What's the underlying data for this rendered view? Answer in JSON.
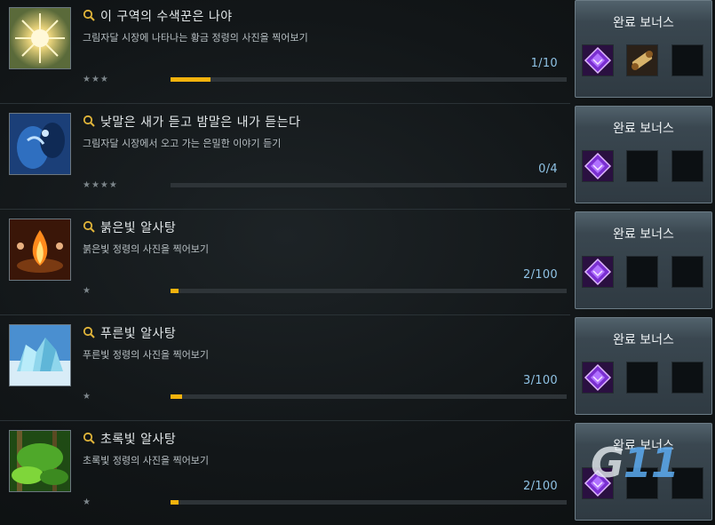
{
  "bonus_label": "완료 보너스",
  "watermark": {
    "prefix": "G",
    "suffix": "11"
  },
  "quests": [
    {
      "title": "이 구역의 수색꾼은 나야",
      "desc": "그림자달 시장에 나타나는 황금 정령의 사진을 찍어보기",
      "count": "1/10",
      "progress": 0.1,
      "stars": "★★★",
      "thumb": "golden-spirit",
      "rewards": [
        "purple-gem-icon",
        "scroll-icon"
      ]
    },
    {
      "title": "낮말은 새가 듣고 밤말은 내가 듣는다",
      "desc": "그림자달 시장에서 오고 가는 은밀한 이야기 듣기",
      "count": "0/4",
      "progress": 0.0,
      "stars": "★★★★",
      "thumb": "whisper",
      "rewards": [
        "purple-gem-icon"
      ]
    },
    {
      "title": "붉은빛 알사탕",
      "desc": "붉은빛 정령의 사진을 찍어보기",
      "count": "2/100",
      "progress": 0.02,
      "stars": "★",
      "thumb": "red-fire",
      "rewards": [
        "purple-gem-icon"
      ]
    },
    {
      "title": "푸른빛 알사탕",
      "desc": "푸른빛 정령의 사진을 찍어보기",
      "count": "3/100",
      "progress": 0.03,
      "stars": "★",
      "thumb": "blue-ice",
      "rewards": [
        "purple-gem-icon"
      ]
    },
    {
      "title": "초록빛 알사탕",
      "desc": "초록빛 정령의 사진을 찍어보기",
      "count": "2/100",
      "progress": 0.02,
      "stars": "★",
      "thumb": "green-forest",
      "rewards": [
        "purple-gem-icon"
      ]
    }
  ],
  "colors": {
    "progress": "#f2b20d",
    "count": "#8fc2e4",
    "gem": "#a64dff"
  }
}
